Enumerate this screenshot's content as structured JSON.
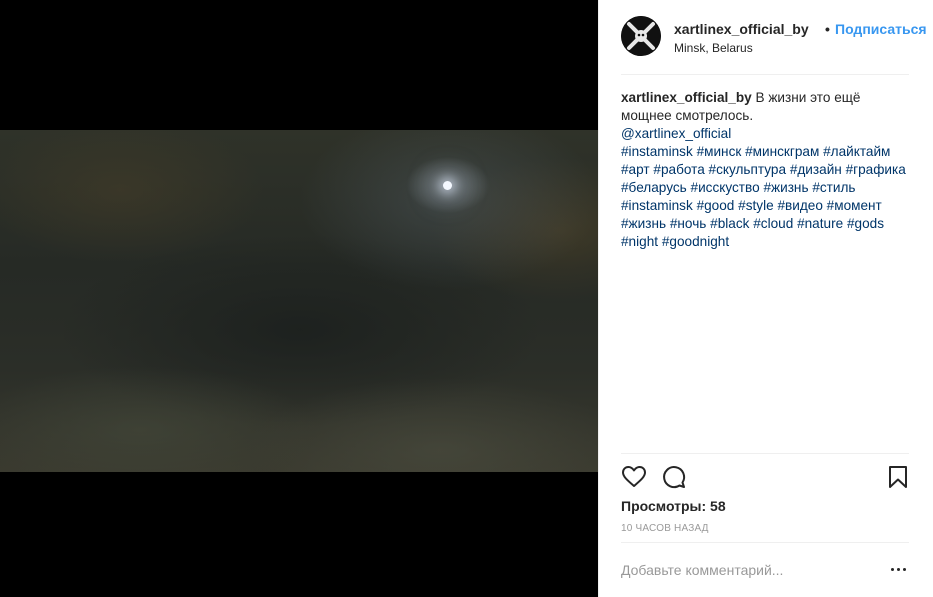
{
  "post": {
    "username": "xartlinex_official_by",
    "separator": "•",
    "follow_label": "Подписаться",
    "location": "Minsk, Belarus"
  },
  "caption": {
    "username": "xartlinex_official_by",
    "text_line": "В жизни это ещё мощнее смотрелось.",
    "mention": "@xartlinex_official",
    "hashtags": [
      "#instaminsk",
      "#минск",
      "#минскграм",
      "#лайктайм",
      "#арт",
      "#работа",
      "#скульптура",
      "#дизайн",
      "#графика",
      "#беларусь",
      "#исскуство",
      "#жизнь",
      "#стиль",
      "#instaminsk",
      "#good",
      "#style",
      "#видео",
      "#момент",
      "#жизнь",
      "#ночь",
      "#black",
      "#cloud",
      "#nature",
      "#gods",
      "#night",
      "#goodnight"
    ]
  },
  "stats": {
    "views_text": "Просмотры: 58",
    "timestamp": "10 ЧАСОВ НАЗАД"
  },
  "comment": {
    "placeholder": "Добавьте комментарий..."
  },
  "icons": {
    "like": "heart-icon",
    "comment": "comment-icon",
    "save": "bookmark-icon",
    "more": "more-options-icon"
  }
}
